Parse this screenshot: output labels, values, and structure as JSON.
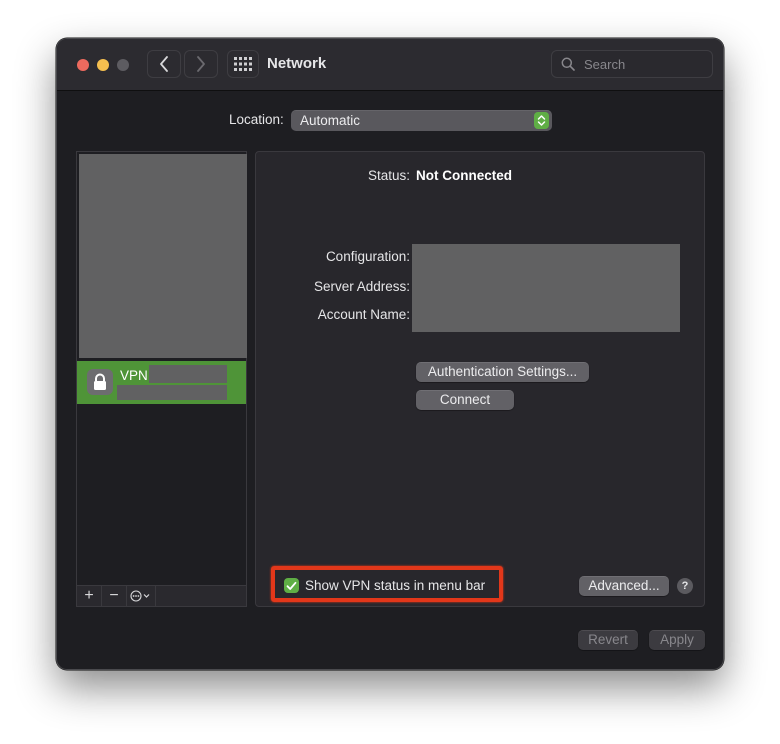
{
  "window": {
    "title": "Network"
  },
  "search": {
    "placeholder": "Search"
  },
  "location": {
    "label": "Location:",
    "value": "Automatic"
  },
  "sidebar": {
    "items": [
      {
        "label": "VPN",
        "icon": "lock-icon",
        "color": "#4f9438"
      }
    ],
    "footer": {
      "add_label": "+",
      "remove_label": "−"
    }
  },
  "details": {
    "status_label": "Status:",
    "status_value": "Not Connected",
    "configuration_label": "Configuration:",
    "server_address_label": "Server Address:",
    "account_name_label": "Account Name:",
    "auth_settings_label": "Authentication Settings...",
    "connect_label": "Connect",
    "show_vpn_status_label": "Show VPN status in menu bar",
    "show_vpn_status_checked": true,
    "advanced_label": "Advanced...",
    "help_label": "?"
  },
  "footer": {
    "revert_label": "Revert",
    "apply_label": "Apply"
  },
  "colors": {
    "accent": "#5fae45",
    "highlight": "#e2371a",
    "window_bg": "#1e1e22"
  }
}
